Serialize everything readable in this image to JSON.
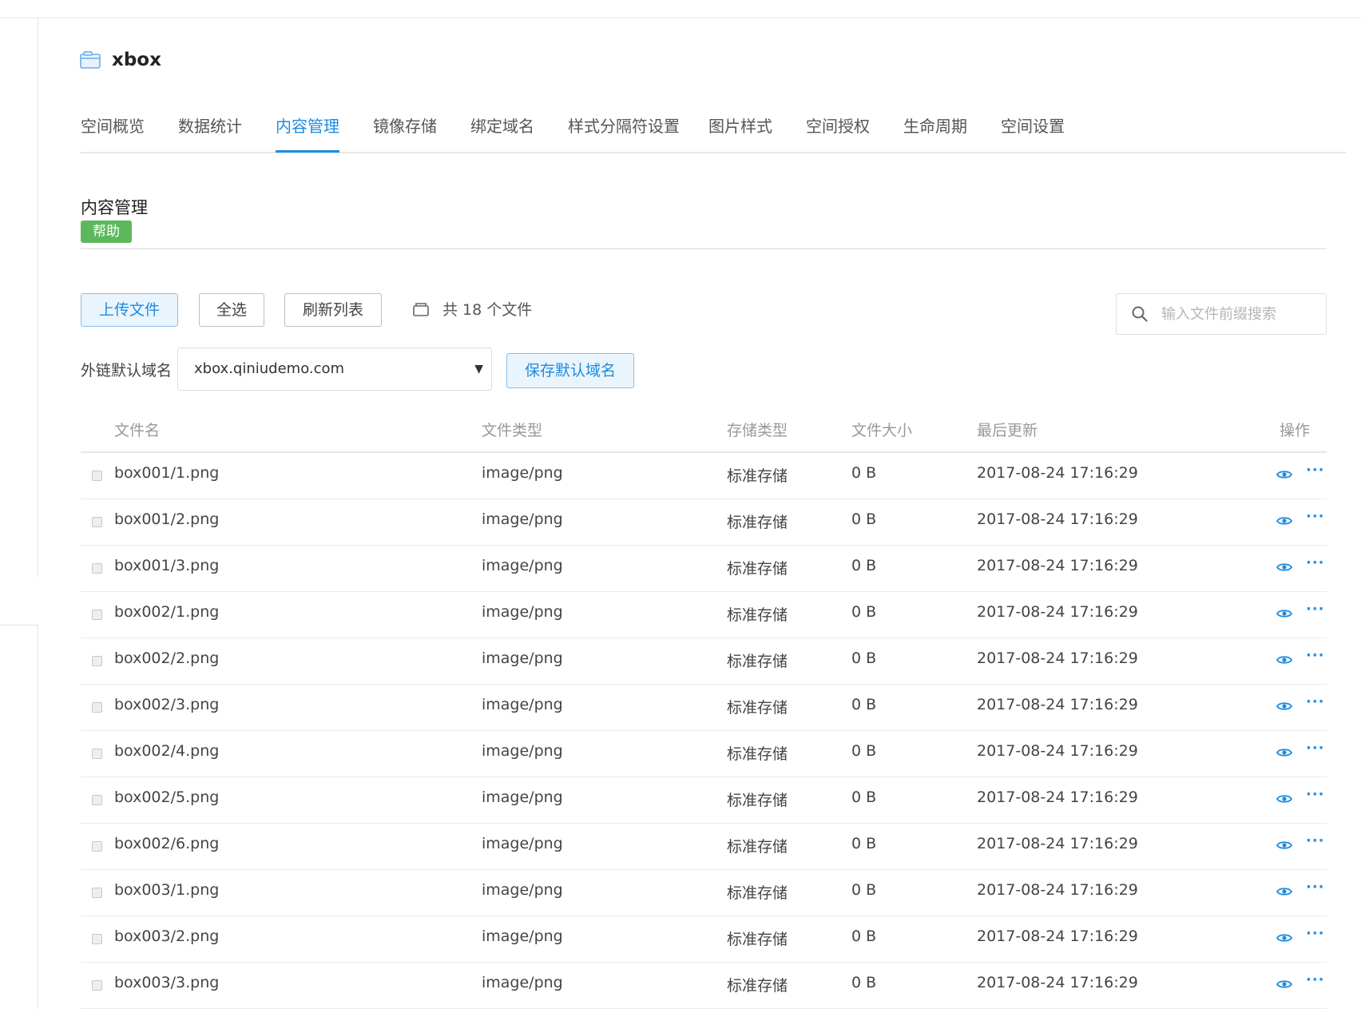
{
  "bucket": {
    "name": "xbox",
    "icon": "bucket-icon"
  },
  "tabs": [
    {
      "label": "空间概览",
      "active": false
    },
    {
      "label": "数据统计",
      "active": false
    },
    {
      "label": "内容管理",
      "active": true
    },
    {
      "label": "镜像存储",
      "active": false
    },
    {
      "label": "绑定域名",
      "active": false
    },
    {
      "label": "样式分隔符设置",
      "active": false
    },
    {
      "label": "图片样式",
      "active": false
    },
    {
      "label": "空间授权",
      "active": false
    },
    {
      "label": "生命周期",
      "active": false
    },
    {
      "label": "空间设置",
      "active": false
    }
  ],
  "section": {
    "title": "内容管理",
    "help": "帮助"
  },
  "toolbar": {
    "upload_label": "上传文件",
    "select_all_label": "全选",
    "refresh_label": "刷新列表",
    "file_count_text": "共 18 个文件",
    "search_placeholder": "输入文件前缀搜索"
  },
  "domain": {
    "label": "外链默认域名",
    "selected": "xbox.qiniudemo.com",
    "save_label": "保存默认域名"
  },
  "table": {
    "columns": [
      "文件名",
      "文件类型",
      "存储类型",
      "文件大小",
      "最后更新",
      "操作"
    ],
    "rows": [
      {
        "name": "box001/1.png",
        "type": "image/png",
        "storage": "标准存储",
        "size": "0 B",
        "updated": "2017-08-24 17:16:29"
      },
      {
        "name": "box001/2.png",
        "type": "image/png",
        "storage": "标准存储",
        "size": "0 B",
        "updated": "2017-08-24 17:16:29"
      },
      {
        "name": "box001/3.png",
        "type": "image/png",
        "storage": "标准存储",
        "size": "0 B",
        "updated": "2017-08-24 17:16:29"
      },
      {
        "name": "box002/1.png",
        "type": "image/png",
        "storage": "标准存储",
        "size": "0 B",
        "updated": "2017-08-24 17:16:29"
      },
      {
        "name": "box002/2.png",
        "type": "image/png",
        "storage": "标准存储",
        "size": "0 B",
        "updated": "2017-08-24 17:16:29"
      },
      {
        "name": "box002/3.png",
        "type": "image/png",
        "storage": "标准存储",
        "size": "0 B",
        "updated": "2017-08-24 17:16:29"
      },
      {
        "name": "box002/4.png",
        "type": "image/png",
        "storage": "标准存储",
        "size": "0 B",
        "updated": "2017-08-24 17:16:29"
      },
      {
        "name": "box002/5.png",
        "type": "image/png",
        "storage": "标准存储",
        "size": "0 B",
        "updated": "2017-08-24 17:16:29"
      },
      {
        "name": "box002/6.png",
        "type": "image/png",
        "storage": "标准存储",
        "size": "0 B",
        "updated": "2017-08-24 17:16:29"
      },
      {
        "name": "box003/1.png",
        "type": "image/png",
        "storage": "标准存储",
        "size": "0 B",
        "updated": "2017-08-24 17:16:29"
      },
      {
        "name": "box003/2.png",
        "type": "image/png",
        "storage": "标准存储",
        "size": "0 B",
        "updated": "2017-08-24 17:16:29"
      },
      {
        "name": "box003/3.png",
        "type": "image/png",
        "storage": "标准存储",
        "size": "0 B",
        "updated": "2017-08-24 17:16:29"
      }
    ],
    "row_actions": {
      "preview_icon": "eye-icon",
      "more_label": "···"
    }
  },
  "colors": {
    "accent": "#1d8ce0",
    "help_badge": "#5cb85c"
  }
}
